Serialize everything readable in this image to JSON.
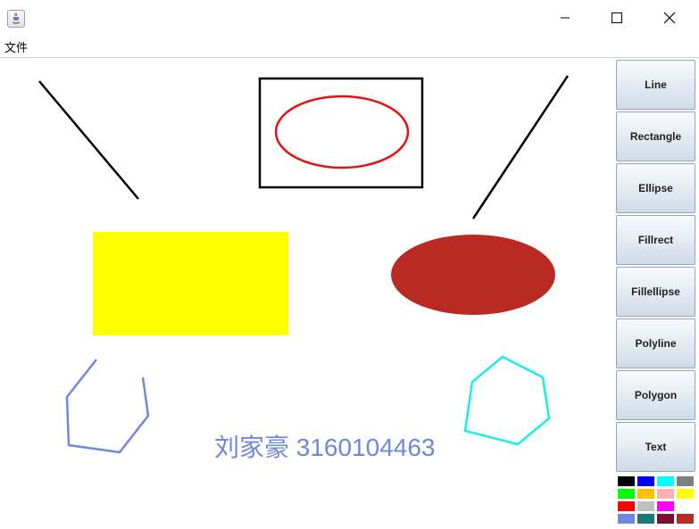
{
  "window": {
    "menu_label": "文件"
  },
  "toolbar": {
    "buttons": [
      "Line",
      "Rectangle",
      "Ellipse",
      "Fillrect",
      "Fillellipse",
      "Polyline",
      "Polygon",
      "Text"
    ]
  },
  "canvas": {
    "text_label": "刘家豪 3160104463",
    "colors": {
      "line": "#000000",
      "rect_outline": "#000000",
      "ellipse_outline": "#e81010",
      "fill_rect": "#ffff00",
      "fill_ellipse": "#b82a22",
      "polyline": "#6d88dd",
      "polygon": "#19eded",
      "text": "#6d88dd"
    }
  },
  "palette": {
    "colors": [
      "#000000",
      "#0000ff",
      "#00ffff",
      "#808080",
      "#00ff00",
      "#ffc000",
      "#ffb0b0",
      "#ffff00",
      "#ff0000",
      "#c0c0c0",
      "#ff00ff",
      "#ffffff",
      "#6d88dd",
      "#1b7a78",
      "#7a1030",
      "#b82a22"
    ]
  }
}
